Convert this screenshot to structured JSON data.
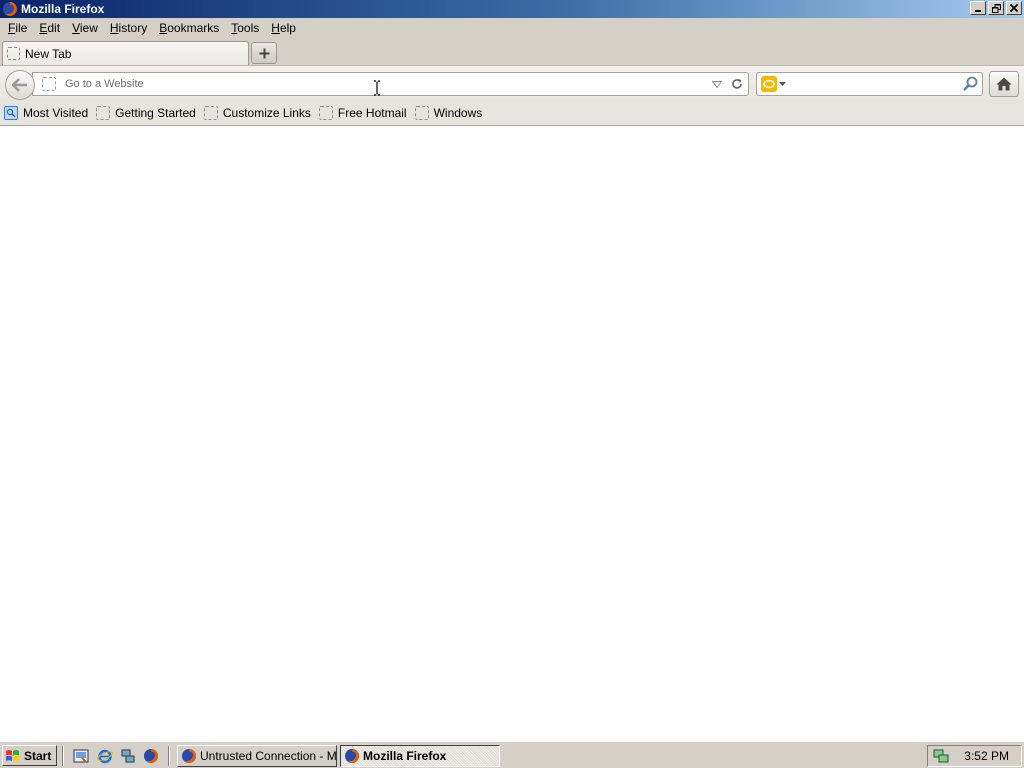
{
  "window": {
    "title": "Mozilla Firefox"
  },
  "menu": {
    "items": [
      {
        "label": "File",
        "key": "F",
        "rest": "ile"
      },
      {
        "label": "Edit",
        "key": "E",
        "rest": "dit"
      },
      {
        "label": "View",
        "key": "V",
        "rest": "iew"
      },
      {
        "label": "History",
        "key": "H",
        "rest": "istory"
      },
      {
        "label": "Bookmarks",
        "key": "B",
        "rest": "ookmarks"
      },
      {
        "label": "Tools",
        "key": "T",
        "rest": "ools"
      },
      {
        "label": "Help",
        "key": "H",
        "rest": "elp"
      }
    ]
  },
  "tabs": [
    {
      "label": "New Tab"
    }
  ],
  "navbar": {
    "url_placeholder": "Go to a Website",
    "url_value": "",
    "search_value": ""
  },
  "bookmarks": [
    {
      "label": "Most Visited",
      "icon": "most-visited-icon"
    },
    {
      "label": "Getting Started",
      "icon": "page-icon"
    },
    {
      "label": "Customize Links",
      "icon": "page-icon"
    },
    {
      "label": "Free Hotmail",
      "icon": "page-icon"
    },
    {
      "label": "Windows",
      "icon": "page-icon"
    }
  ],
  "taskbar": {
    "start_label": "Start",
    "tasks": [
      {
        "label": "Untrusted Connection - M...",
        "active": false
      },
      {
        "label": "Mozilla Firefox",
        "active": true
      }
    ],
    "clock": "3:52 PM"
  },
  "colors": {
    "titlebar_start": "#0a246a",
    "titlebar_end": "#a6caf0",
    "chrome": "#d4d0c8"
  }
}
